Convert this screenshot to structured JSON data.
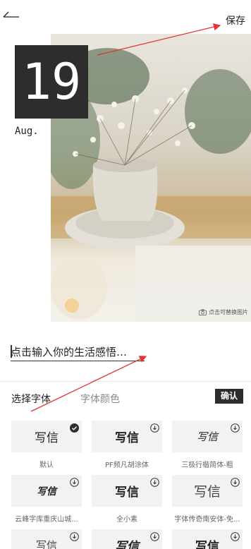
{
  "header": {
    "save_label": "保存",
    "back_icon": "back-arrow-icon"
  },
  "card": {
    "day": "19",
    "month": "Aug.",
    "replace_photo_hint": "点击可替换图片"
  },
  "text_input": {
    "placeholder": "点击输入你的生活感悟…"
  },
  "tabs": [
    {
      "label": "选择字体",
      "active": true
    },
    {
      "label": "字体颜色",
      "active": false
    }
  ],
  "confirm_label": "确认",
  "fonts": [
    {
      "sample": "写信",
      "name": "默认",
      "state": "selected"
    },
    {
      "sample": "写信",
      "name": "PF频凡胡涂体",
      "state": "download"
    },
    {
      "sample": "写信",
      "name": "三极行楷简体-粗",
      "state": "download"
    },
    {
      "sample": "写信",
      "name": "云峰字库重庆山城...",
      "state": "download"
    },
    {
      "sample": "写信",
      "name": "全小素",
      "state": "download"
    },
    {
      "sample": "写信",
      "name": "字体传奇南安体-免...",
      "state": "download"
    },
    {
      "sample": "写信",
      "name": "",
      "state": "download"
    },
    {
      "sample": "写信",
      "name": "",
      "state": "download"
    },
    {
      "sample": "写信",
      "name": "",
      "state": "download"
    }
  ],
  "colors": {
    "accent": "#2d2d2d",
    "annotation": "#e3342f"
  }
}
